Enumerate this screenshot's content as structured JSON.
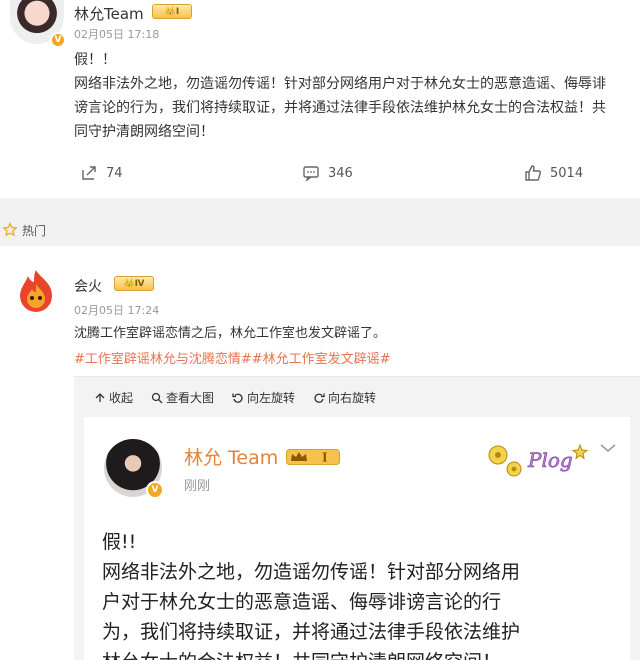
{
  "post1": {
    "author": "林允Team",
    "vip_level": "Ⅰ",
    "time": "02月05日 17:18",
    "lines": [
      "假！！",
      "网络非法外之地，勿造谣勿传谣！针对部分网络用户对于林允女士的恶意造谣、侮辱诽",
      "谤言论的行为，我们将持续取证，并将通过法律手段依法维护林允女士的合法权益！共",
      "同守护清朗网络空间！"
    ],
    "share_count": "74",
    "comment_count": "346",
    "like_count": "5014"
  },
  "hot_label": "热门",
  "post2": {
    "author": "会火",
    "vip_level": "Ⅳ",
    "time": "02月05日 17:24",
    "text": "沈腾工作室辟谣恋情之后，林允工作室也发文辟谣了。",
    "tags": "#工作室辟谣林允与沈腾恋情##林允工作室发文辟谣#"
  },
  "viewer": {
    "collapse": "收起",
    "view_large": "查看大图",
    "rotate_left": "向左旋转",
    "rotate_right": "向右旋转"
  },
  "embedded": {
    "author": "林允 Team",
    "vip_level": "Ⅰ",
    "time": "刚刚",
    "sticker_text": "Plog",
    "lines": [
      "假!!",
      "网络非法外之地，勿造谣勿传谣！针对部分网络用",
      "户对于林允女士的恶意造谣、侮辱诽谤言论的行",
      "为，我们将持续取证，并将通过法律手段依法维护",
      "林允女士的合法权益！共同守护清朗网络空间！"
    ]
  },
  "colors": {
    "orange_name": "#e8823a",
    "tag": "#eb7350",
    "vip_gold": "#f6c24a"
  }
}
